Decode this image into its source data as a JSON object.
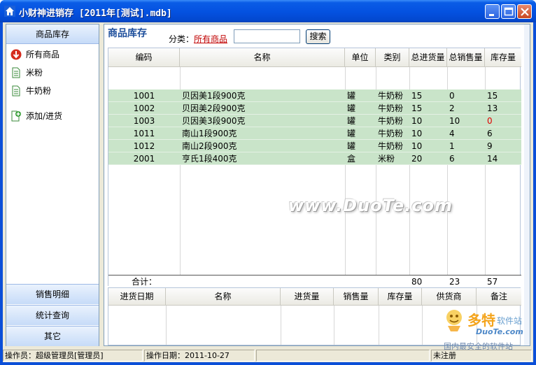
{
  "window": {
    "title": "小财神进销存 [2011年[测试].mdb]"
  },
  "sidebar": {
    "header": "商品库存",
    "items": [
      {
        "label": "所有商品",
        "icon": "down-arrow-icon"
      },
      {
        "label": "米粉",
        "icon": "document-icon"
      },
      {
        "label": "牛奶粉",
        "icon": "document-icon"
      },
      {
        "label": "添加/进货",
        "icon": "add-document-icon"
      }
    ],
    "footer": [
      "销售明细",
      "统计查询",
      "其它"
    ]
  },
  "main": {
    "title": "商品库存",
    "category_label": "分类：",
    "category_value": "所有商品",
    "search_value": "",
    "search_button": "搜索"
  },
  "table": {
    "columns": [
      "编码",
      "名称",
      "单位",
      "类别",
      "总进货量",
      "总销售量",
      "库存量"
    ],
    "rows": [
      [
        "1001",
        "贝因美1段900克",
        "罐",
        "牛奶粉",
        "15",
        "0",
        "15"
      ],
      [
        "1002",
        "贝因美2段900克",
        "罐",
        "牛奶粉",
        "15",
        "2",
        "13"
      ],
      [
        "1003",
        "贝因美3段900克",
        "罐",
        "牛奶粉",
        "10",
        "10",
        "0"
      ],
      [
        "1011",
        "南山1段900克",
        "罐",
        "牛奶粉",
        "10",
        "4",
        "6"
      ],
      [
        "1012",
        "南山2段900克",
        "罐",
        "牛奶粉",
        "10",
        "1",
        "9"
      ],
      [
        "2001",
        "亨氏1段400克",
        "盒",
        "米粉",
        "20",
        "6",
        "14"
      ]
    ],
    "total_label": "合计：",
    "totals": {
      "in": "80",
      "sold": "23",
      "stock": "57"
    }
  },
  "detail_table": {
    "columns": [
      "进货日期",
      "名称",
      "进货量",
      "销售量",
      "库存量",
      "供货商",
      "备注"
    ]
  },
  "statusbar": {
    "operator": "操作员：超级管理员[管理员]",
    "date": "操作日期：2011-10-27",
    "empty": "",
    "registration": "未注册"
  },
  "watermark": {
    "center": "www.DuoTe.com",
    "logo_cn": "多特",
    "logo_sub": "软件站",
    "logo_en": "DuoTe.com",
    "slogan": "国内最安全的软件站"
  },
  "colors": {
    "titlebar": "#0451e0",
    "row_bg": "#c9e4c9",
    "accent_title": "#1e4f9c",
    "warn": "#e00000"
  }
}
